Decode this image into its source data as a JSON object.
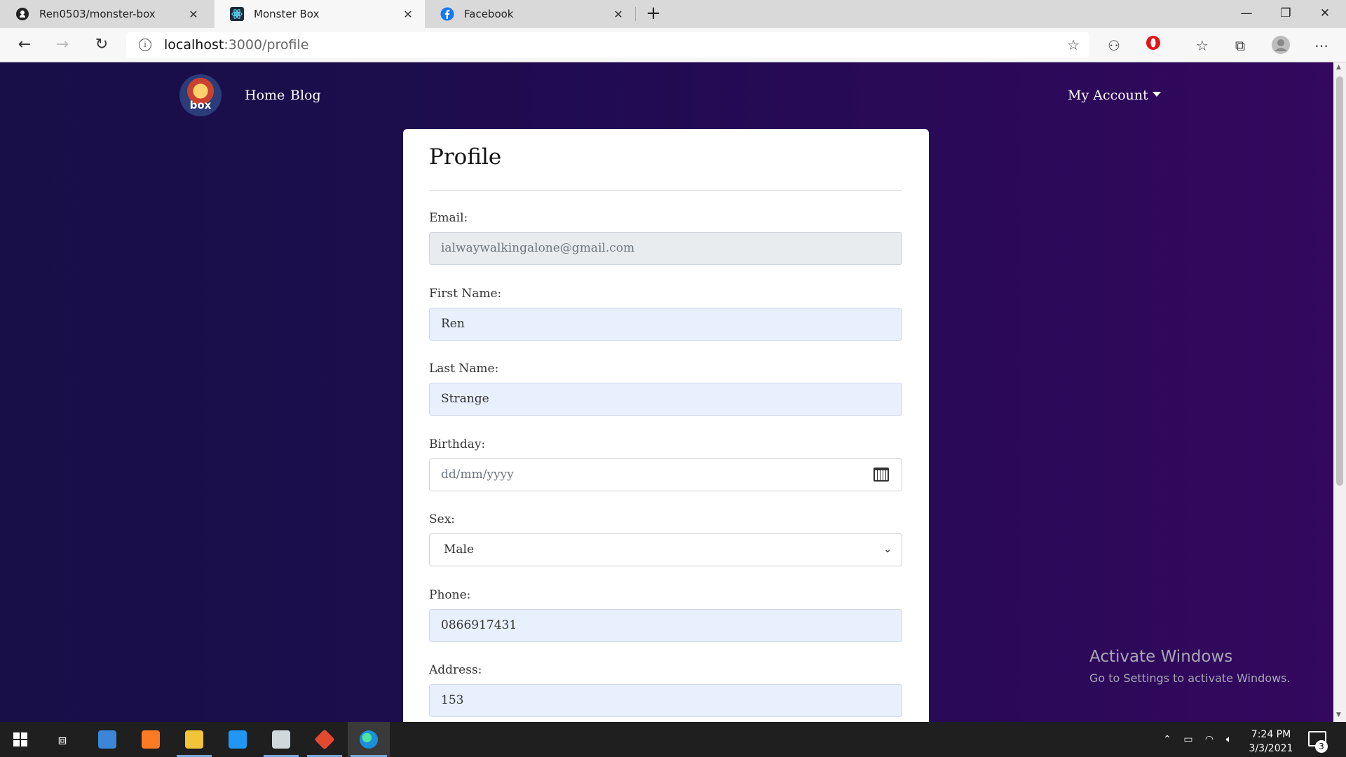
{
  "browser": {
    "tabs": [
      {
        "title": "Ren0503/monster-box",
        "icon": "github-icon",
        "active": false
      },
      {
        "title": "Monster Box",
        "icon": "react-icon",
        "active": true
      },
      {
        "title": "Facebook",
        "icon": "facebook-icon",
        "active": false
      }
    ],
    "new_tab_label": "+",
    "address": {
      "host": "localhost",
      "rest": ":3000/profile"
    }
  },
  "site": {
    "logo_text": "box",
    "nav": {
      "home": "Home",
      "blog": "Blog"
    },
    "account_label": "My Account"
  },
  "profile": {
    "title": "Profile",
    "email": {
      "label": "Email:",
      "value": "ialwaywalkingalone@gmail.com"
    },
    "first_name": {
      "label": "First Name:",
      "value": "Ren"
    },
    "last_name": {
      "label": "Last Name:",
      "value": "Strange"
    },
    "birthday": {
      "label": "Birthday:",
      "placeholder": "dd/mm/yyyy"
    },
    "sex": {
      "label": "Sex:",
      "selected": "Male"
    },
    "phone": {
      "label": "Phone:",
      "value": "0866917431"
    },
    "address": {
      "label": "Address:",
      "value": "153"
    }
  },
  "watermark": {
    "line1": "Activate Windows",
    "line2": "Go to Settings to activate Windows."
  },
  "taskbar": {
    "time": "7:24 PM",
    "date": "3/3/2021",
    "notification_count": "3"
  },
  "colors": {
    "page_bg_start": "#180f48",
    "page_bg_end": "#33085e",
    "autofill_bg": "#e8f0fe",
    "disabled_bg": "#e9ecef"
  }
}
